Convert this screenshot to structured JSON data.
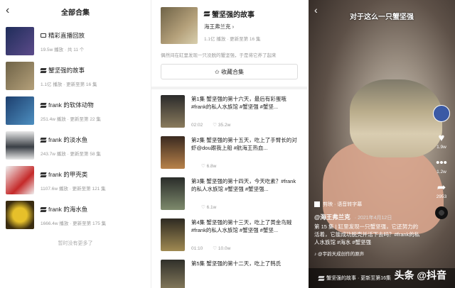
{
  "left": {
    "title": "全部合集",
    "items": [
      {
        "name": "精彩直播回放",
        "meta": "19.5w 播放 · 共 11 个",
        "icon": "tv-icon",
        "color": "#2a3a6c"
      },
      {
        "name": "蟹坚强的故事",
        "meta": "1.1亿 播放 · 更新至第 16 集",
        "icon": "stack-icon",
        "color": "#8f7c55"
      },
      {
        "name": "frank 的软体动物",
        "meta": "251.4w 播放 · 更新至第 22 集",
        "icon": "stack-icon",
        "color": "#3a5f8a"
      },
      {
        "name": "frank 的淡水鱼",
        "meta": "243.7w 播放 · 更新至第 58 集",
        "icon": "stack-icon",
        "color": "#4b5563"
      },
      {
        "name": "frank 的甲壳类",
        "meta": "1107.6w 播放 · 更新至第 121 集",
        "icon": "stack-icon",
        "color": "#8b2c2c"
      },
      {
        "name": "frank 的海水鱼",
        "meta": "1666.4w 播放 · 更新至第 175 集",
        "icon": "stack-icon",
        "color": "#b38b1e"
      }
    ],
    "footer": "暂时没有更多了"
  },
  "middle": {
    "title": "蟹坚强的故事",
    "author": "海王弗兰克 ›",
    "stats": "1.1亿 播放 · 更新至第 16 集",
    "desc": "偶然间在缸里发现一只没脱的蟹坚强，于是将它养了起来",
    "fav_button": "✩ 收藏合集",
    "episodes": [
      {
        "text": "第1集  蟹坚强的第十六天，最后有彩蛋哦#frank的私人水族馆 #蟹坚强 #蟹坚...",
        "time": "02:02",
        "likes": "♡ 35.2w"
      },
      {
        "text": "第2集  蟹坚强的第十五天，吃上了手臂长的对虾@dou跟我上船 #航海王热血...",
        "time": "",
        "likes": "♡ 6.8w"
      },
      {
        "text": "第3集  蟹坚强的第十四天，今天吃素？#frank的私人水族馆 #蟹坚强 #蟹坚强...",
        "time": "",
        "likes": "♡ 6.1w"
      },
      {
        "text": "第4集  蟹坚强的第十三天，吃上了黄金鸟贼#frank的私人水族馆 #蟹坚强 #蟹坚...",
        "time": "01:10",
        "likes": "♡ 10.0w"
      },
      {
        "text": "第5集  蟹坚强的第十二天，吃上了韩氏",
        "time": "",
        "likes": ""
      }
    ]
  },
  "right": {
    "caption_top": "对于这么一只蟹坚强",
    "likes": "1.9w",
    "comments": "1.2w",
    "shares": "2953",
    "jianying": "剪映 · 语音转字幕",
    "user": "@海王弗兰克",
    "date": "· 2021年4月12日",
    "desc": "第 15 集 | 缸里发现一只蟹坚强，它还努力的活着，它能成功脱壳并活下去吗？#frank的私人水族馆 #海水 #蟹坚强",
    "music": "♪ @宇韵天成创作的原声",
    "bar": "蟹坚强的故事 · 更新至第16集",
    "watermark": "头条 @抖音"
  }
}
